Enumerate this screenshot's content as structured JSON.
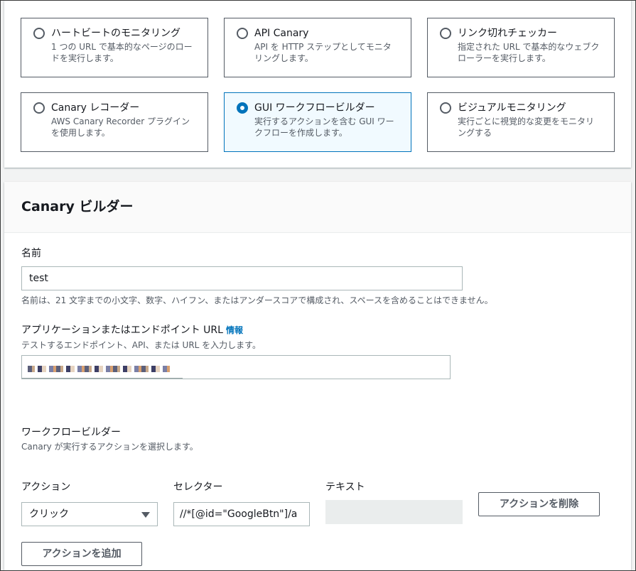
{
  "blueprints": [
    {
      "title": "ハートビートのモニタリング",
      "desc": "1 つの URL で基本的なページのロードを実行します。",
      "selected": false
    },
    {
      "title": "API Canary",
      "desc": "API を HTTP ステップとしてモニタリングします。",
      "selected": false
    },
    {
      "title": "リンク切れチェッカー",
      "desc": "指定された URL で基本的なウェブクローラーを実行します。",
      "selected": false
    },
    {
      "title": "Canary レコーダー",
      "desc": "AWS Canary Recorder プラグインを使用します。",
      "selected": false
    },
    {
      "title": "GUI ワークフロービルダー",
      "desc": "実行するアクションを含む GUI ワークフローを作成します。",
      "selected": true
    },
    {
      "title": "ビジュアルモニタリング",
      "desc": "実行ごとに視覚的な変更をモニタリングする",
      "selected": false
    }
  ],
  "builder": {
    "title": "Canary ビルダー",
    "name_label": "名前",
    "name_value": "test",
    "name_hint": "名前は、21 文字までの小文字、数字、ハイフン、またはアンダースコアで構成され、スペースを含めることはできません。",
    "url_label": "アプリケーションまたはエンドポイント URL",
    "url_info": "情報",
    "url_hint": "テストするエンドポイント、API、または URL を入力します。",
    "workflow_label": "ワークフロービルダー",
    "workflow_hint": "Canary が実行するアクションを選択します。",
    "action_label": "アクション",
    "selector_label": "セレクター",
    "text_label": "テキスト",
    "action_value": "クリック",
    "selector_value": "//*[@id=\"GoogleBtn\"]/a",
    "remove_button": "アクションを削除",
    "add_button": "アクションを追加"
  },
  "colors": {
    "accent": "#0073bb",
    "border": "#545b64",
    "text": "#16191f",
    "muted": "#545b64",
    "background": "#f2f3f3"
  }
}
